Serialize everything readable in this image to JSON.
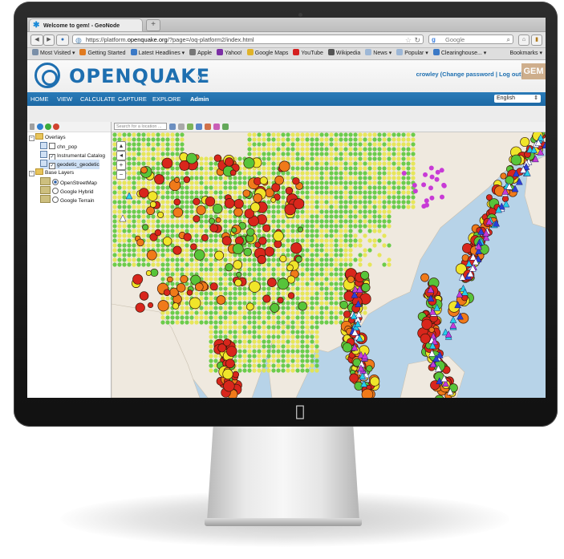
{
  "browser": {
    "tab_title": "Welcome to gem! - GeoNode",
    "new_tab": "+",
    "url_prefix": "https://platform.",
    "url_host": "openquake.org",
    "url_path": "/?page=/oq-platform2/index.html",
    "search_engine": "Google",
    "bookmarks": [
      {
        "label": "Most Visited ▾",
        "color": "#7a8fa8"
      },
      {
        "label": "Getting Started",
        "color": "#e07a1f"
      },
      {
        "label": "Latest Headlines ▾",
        "color": "#3b79c6"
      },
      {
        "label": "Apple",
        "color": "#777777"
      },
      {
        "label": "Yahoo!",
        "color": "#7b2fa5"
      },
      {
        "label": "Google Maps",
        "color": "#e0b32a"
      },
      {
        "label": "YouTube",
        "color": "#d52020"
      },
      {
        "label": "Wikipedia",
        "color": "#555555"
      },
      {
        "label": "News ▾",
        "color": "#9db7d6"
      },
      {
        "label": "Popular ▾",
        "color": "#9db7d6"
      },
      {
        "label": "Clearinghouse... ▾",
        "color": "#3b79c6"
      }
    ],
    "bookmarks_menu": "Bookmarks ▾"
  },
  "app": {
    "logo": "OPENQUAKE",
    "user_line": "crowley (Change password | Log out)",
    "gem_badge": "GEM",
    "menu": [
      "HOME",
      "VIEW",
      "CALCULATE",
      "CAPTURE",
      "EXPLORE",
      "Admin"
    ],
    "language": "English"
  },
  "layer_tree": {
    "overlays_label": "Overlays",
    "overlays": [
      {
        "label": "chn_pop",
        "checked": false
      },
      {
        "label": "Instrumental Catalog",
        "checked": true
      },
      {
        "label": "geodetic_geodetic",
        "checked": true
      }
    ],
    "base_label": "Base Layers",
    "base_layers": [
      {
        "label": "OpenStreetMap",
        "selected": true
      },
      {
        "label": "Google Hybrid",
        "selected": false
      },
      {
        "label": "Google Terrain",
        "selected": false
      }
    ]
  },
  "map": {
    "search_placeholder": "Search for a location ...",
    "zoom_in": "+",
    "zoom_out": "−",
    "colors": {
      "land": "#efe9df",
      "sea": "#b7d3e8",
      "hazard_green": "#5cc93a",
      "hazard_yellow": "#e4e64a",
      "hazard_orange": "#f0a030",
      "quake_red": "#d8261c",
      "quake_orange": "#f07a1a",
      "quake_yellow": "#f0e52a",
      "quake_green": "#57c43a",
      "geodetic_purple": "#c83ad6",
      "geodetic_cyan": "#26d0e8",
      "geodetic_blue": "#2b3fd8"
    }
  }
}
